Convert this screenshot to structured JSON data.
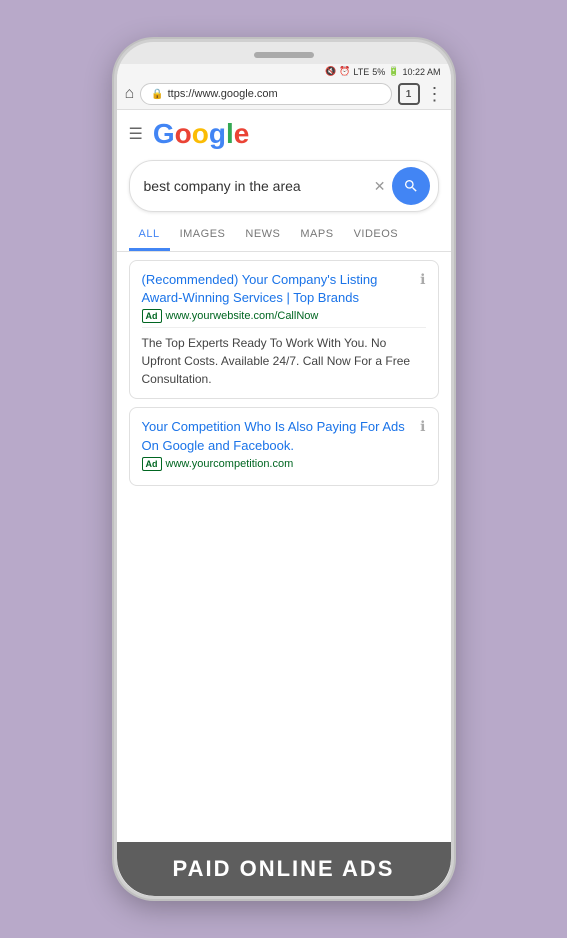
{
  "phone": {
    "status_bar": {
      "time": "10:22 AM",
      "battery": "5%",
      "network": "LTE"
    },
    "browser": {
      "url": "ttps://www.google.com"
    },
    "tab_count": "1",
    "google": {
      "logo_letters": [
        {
          "letter": "G",
          "color": "blue"
        },
        {
          "letter": "o",
          "color": "red"
        },
        {
          "letter": "o",
          "color": "yellow"
        },
        {
          "letter": "g",
          "color": "blue"
        },
        {
          "letter": "l",
          "color": "green"
        },
        {
          "letter": "e",
          "color": "red"
        }
      ],
      "search_query": "best company in the area",
      "tabs": [
        "ALL",
        "IMAGES",
        "NEWS",
        "MAPS",
        "VIDEOS"
      ],
      "active_tab": "ALL",
      "results": [
        {
          "title": "(Recommended) Your Company's Listing Award-Winning Services | Top Brands",
          "ad_label": "Ad",
          "url": "www.yourwebsite.com/CallNow",
          "description": "The Top Experts Ready To Work With You. No Upfront Costs. Available 24/7. Call Now For a Free Consultation."
        },
        {
          "title": "Your Competition Who Is Also Paying For Ads On Google and Facebook.",
          "ad_label": "Ad",
          "url": "www.yourcompetition.com",
          "description": ""
        }
      ]
    },
    "bottom_label": "PAID ONLINE ADS"
  }
}
